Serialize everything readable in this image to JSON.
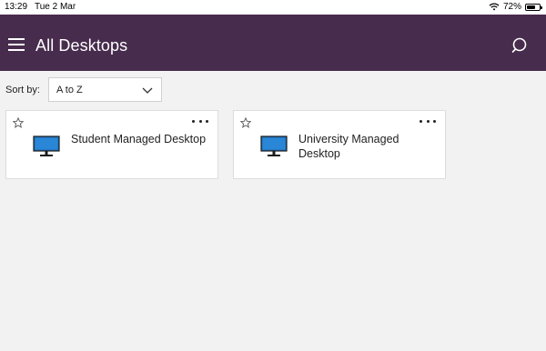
{
  "status_bar": {
    "time": "13:29",
    "date": "Tue 2 Mar",
    "battery": "72%",
    "battery_level": 0.72,
    "icons": [
      "wifi-icon",
      "battery-icon"
    ]
  },
  "header": {
    "title": "All Desktops",
    "background_color": "#472c4d",
    "icons": [
      "menu-icon",
      "search-icon"
    ]
  },
  "sort": {
    "label": "Sort by:",
    "selected": "A to Z"
  },
  "desktops": [
    {
      "name": "Student Managed Desktop",
      "favorite": false,
      "icon": "monitor-icon"
    },
    {
      "name": "University Managed Desktop",
      "favorite": false,
      "icon": "monitor-icon"
    }
  ]
}
